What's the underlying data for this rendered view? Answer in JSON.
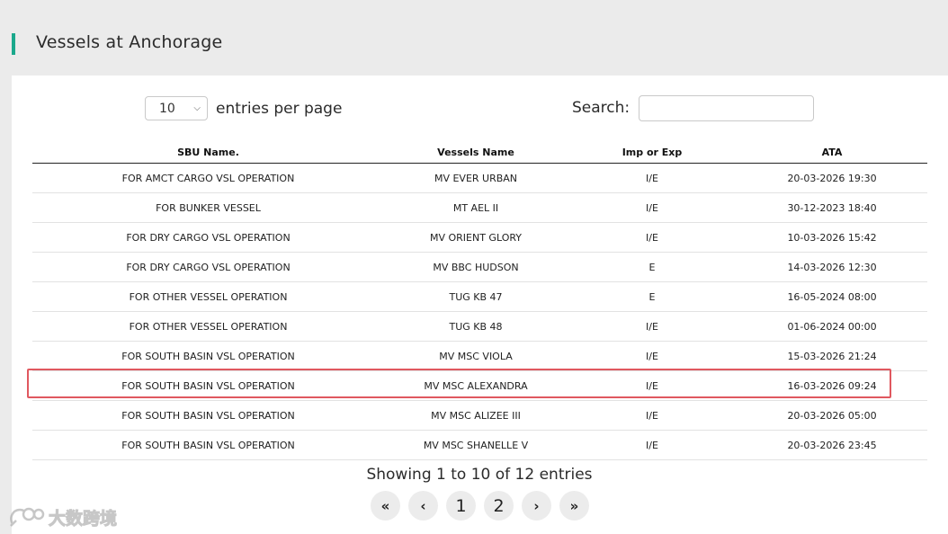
{
  "header": {
    "title": "Vessels at Anchorage",
    "accent_color": "#1aa88c"
  },
  "controls": {
    "page_size_value": "10",
    "entries_label": "entries per page",
    "search_label": "Search:",
    "search_value": "",
    "search_placeholder": ""
  },
  "table": {
    "headers": [
      "SBU Name.",
      "Vessels Name",
      "Imp or Exp",
      "ATA"
    ],
    "rows": [
      [
        "FOR AMCT CARGO VSL OPERATION",
        "MV EVER URBAN",
        "I/E",
        "20-03-2026 19:30"
      ],
      [
        "FOR BUNKER VESSEL",
        "MT AEL II",
        "I/E",
        "30-12-2023 18:40"
      ],
      [
        "FOR DRY CARGO VSL OPERATION",
        "MV ORIENT GLORY",
        "I/E",
        "10-03-2026 15:42"
      ],
      [
        "FOR DRY CARGO VSL OPERATION",
        "MV BBC HUDSON",
        "E",
        "14-03-2026 12:30"
      ],
      [
        "FOR OTHER VESSEL OPERATION",
        "TUG KB 47",
        "E",
        "16-05-2024 08:00"
      ],
      [
        "FOR OTHER VESSEL OPERATION",
        "TUG KB 48",
        "I/E",
        "01-06-2024 00:00"
      ],
      [
        "FOR SOUTH BASIN VSL OPERATION",
        "MV MSC VIOLA",
        "I/E",
        "15-03-2026 21:24"
      ],
      [
        "FOR SOUTH BASIN VSL OPERATION",
        "MV MSC ALEXANDRA",
        "I/E",
        "16-03-2026 09:24"
      ],
      [
        "FOR SOUTH BASIN VSL OPERATION",
        "MV MSC ALIZEE III",
        "I/E",
        "20-03-2026 05:00"
      ],
      [
        "FOR SOUTH BASIN VSL OPERATION",
        "MV MSC SHANELLE V",
        "I/E",
        "20-03-2026 23:45"
      ]
    ],
    "highlight_color": "#e0585f"
  },
  "footer": {
    "summary": "Showing 1 to 10 of 12 entries",
    "pagination": {
      "first": "«",
      "prev": "‹",
      "pages": [
        "1",
        "2"
      ],
      "next": "›",
      "last": "»"
    }
  },
  "watermark": {
    "text": "大数跨境",
    "icon": "chat-bubble-logo-icon"
  }
}
